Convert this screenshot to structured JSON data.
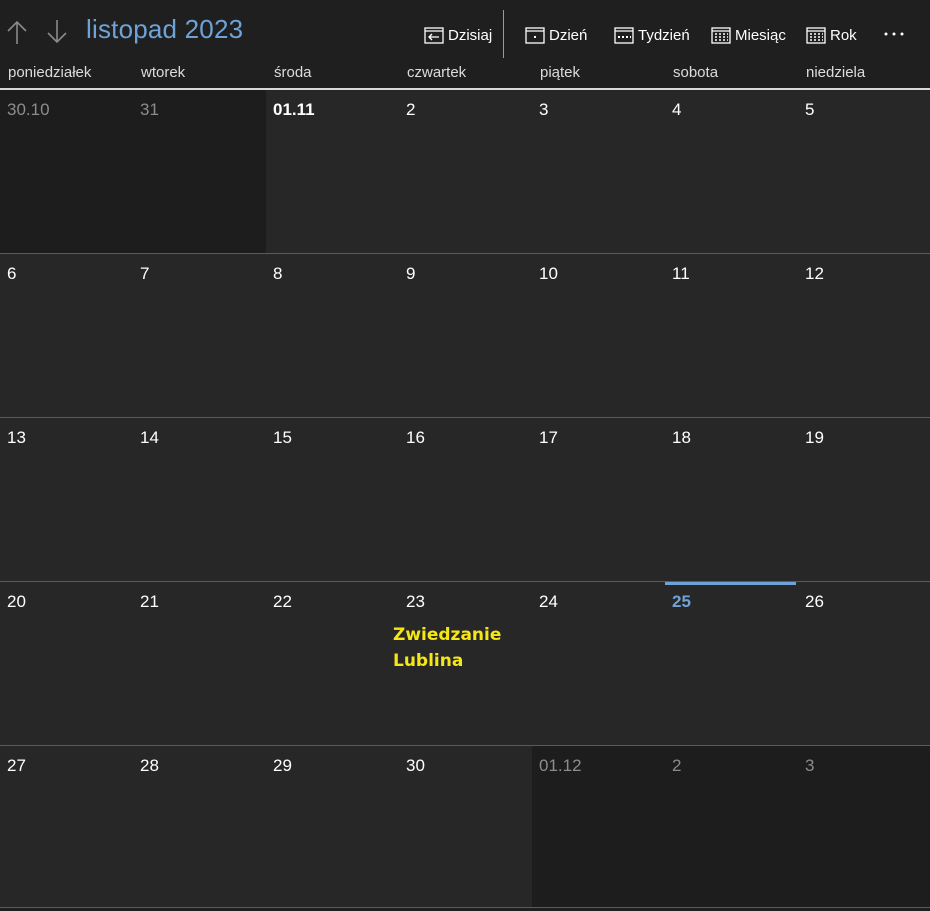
{
  "header": {
    "title": "listopad 2023",
    "today_label": "Dzisiaj",
    "day_label": "Dzień",
    "week_label": "Tydzień",
    "month_label": "Miesiąc",
    "year_label": "Rok"
  },
  "weekdays": [
    "poniedziałek",
    "wtorek",
    "środa",
    "czwartek",
    "piątek",
    "sobota",
    "niedziela"
  ],
  "weeks": [
    [
      {
        "label": "30.10",
        "other": true
      },
      {
        "label": "31",
        "other": true
      },
      {
        "label": "01.11",
        "first": true
      },
      {
        "label": "2"
      },
      {
        "label": "3"
      },
      {
        "label": "4"
      },
      {
        "label": "5"
      }
    ],
    [
      {
        "label": "6"
      },
      {
        "label": "7"
      },
      {
        "label": "8"
      },
      {
        "label": "9"
      },
      {
        "label": "10"
      },
      {
        "label": "11"
      },
      {
        "label": "12"
      }
    ],
    [
      {
        "label": "13"
      },
      {
        "label": "14"
      },
      {
        "label": "15"
      },
      {
        "label": "16"
      },
      {
        "label": "17"
      },
      {
        "label": "18"
      },
      {
        "label": "19"
      }
    ],
    [
      {
        "label": "20"
      },
      {
        "label": "21"
      },
      {
        "label": "22"
      },
      {
        "label": "23",
        "event": "Zwiedzanie Lublina"
      },
      {
        "label": "24"
      },
      {
        "label": "25",
        "today": true
      },
      {
        "label": "26"
      }
    ],
    [
      {
        "label": "27"
      },
      {
        "label": "28"
      },
      {
        "label": "29"
      },
      {
        "label": "30"
      },
      {
        "label": "01.12",
        "other": true
      },
      {
        "label": "2",
        "other": true
      },
      {
        "label": "3",
        "other": true
      }
    ]
  ],
  "colors": {
    "accent": "#6fa3d8",
    "event": "#f5e616",
    "background": "#272727",
    "outside_month": "#1d1d1d"
  },
  "icons": {
    "prev": "arrow-up-icon",
    "next": "arrow-down-icon",
    "more": "more-icon"
  }
}
